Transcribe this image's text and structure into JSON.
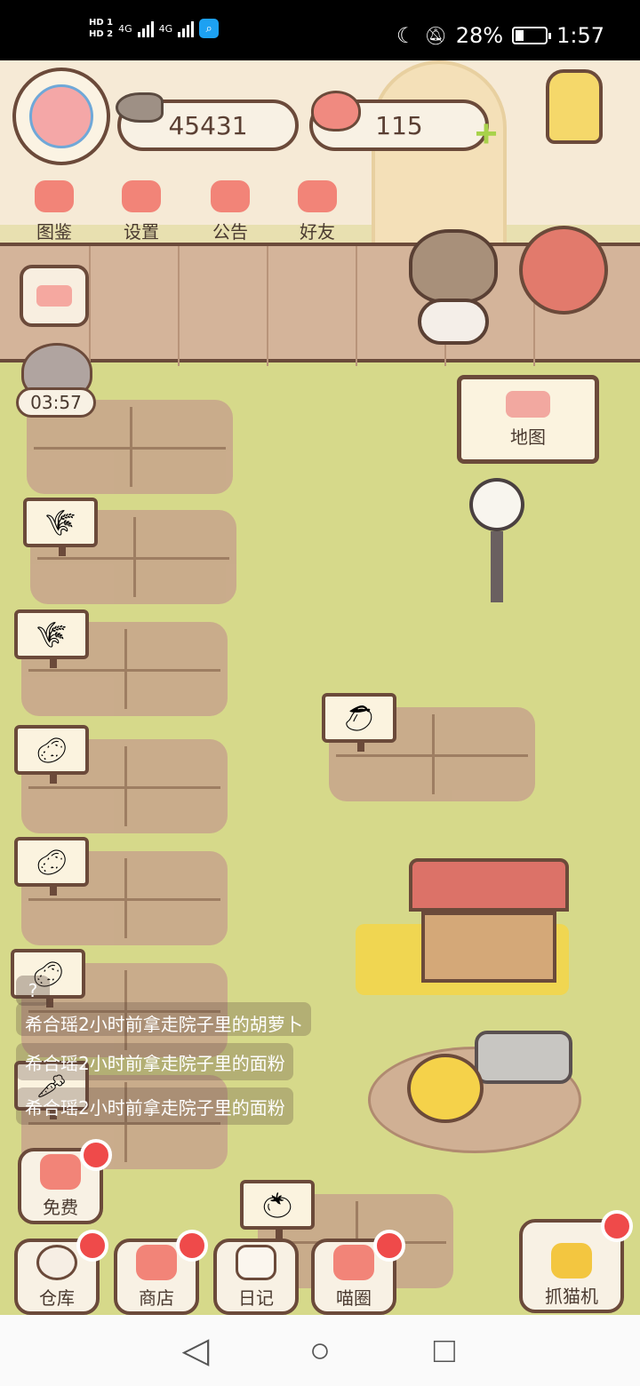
{
  "status_bar": {
    "network_label_1": "HD 1",
    "network_label_2": "HD 2",
    "signal_1": "4G",
    "signal_2": "4G",
    "app_icon": "search-app-icon",
    "dnd_icon": "moon-icon",
    "mute_icon": "bell-off-icon",
    "battery_percent": "28%",
    "battery_level": 0.28,
    "time": "1:57"
  },
  "hud": {
    "fish_count": "45431",
    "heart_count": "115",
    "plus_label": "+",
    "menu": [
      {
        "label": "图鉴",
        "icon": "cat-head-icon"
      },
      {
        "label": "设置",
        "icon": "gear-icon"
      },
      {
        "label": "公告",
        "icon": "gift-icon"
      },
      {
        "label": "好友",
        "icon": "friends-icon"
      }
    ],
    "timer": "03:57"
  },
  "map_sign": {
    "label": "地图"
  },
  "crop_signs": [
    "wheat",
    "wheat",
    "potato",
    "potato",
    "potato",
    "carrot",
    "mango",
    "tomato"
  ],
  "feed": [
    "希合瑶2小时前拿走院子里的胡萝卜",
    "希合瑶2小时前拿走院子里的面粉",
    "希合瑶2小时前拿走院子里的面粉"
  ],
  "feed_help": "?",
  "buttons": {
    "free": "免费",
    "warehouse": "仓库",
    "shop": "商店",
    "diary": "日记",
    "meow_circle": "喵圈",
    "claw_machine": "抓猫机"
  },
  "nav": {
    "back": "◁",
    "home": "○",
    "recents": "□"
  }
}
